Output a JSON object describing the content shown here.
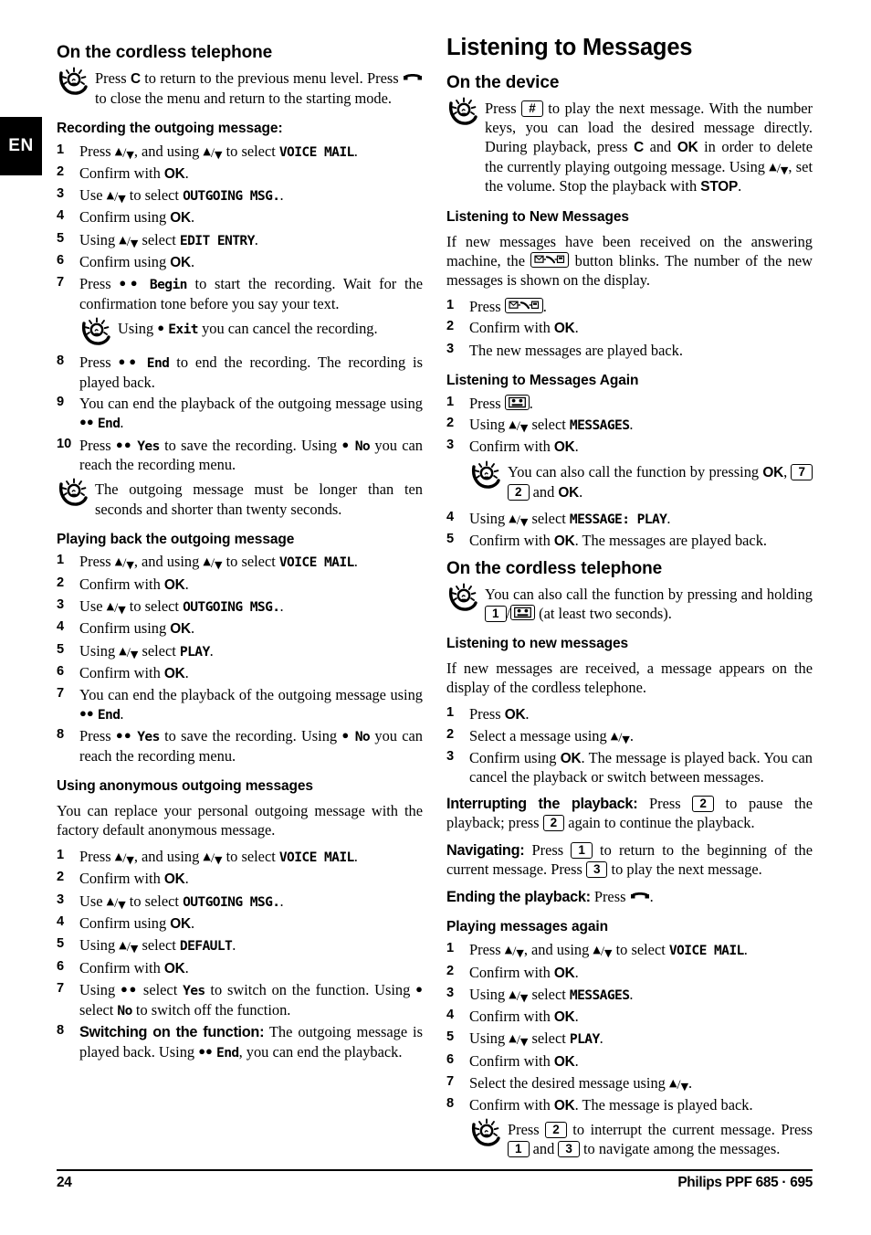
{
  "language_tab": "EN",
  "footer": {
    "page_number": "24",
    "product": "Philips PPF 685 · 695"
  },
  "left_column": {
    "section1_heading": "On the cordless telephone",
    "section1_tip_a": "Press ",
    "section1_tip_key": "C",
    "section1_tip_b": " to return to the previous menu level. Press ",
    "section1_tip_c": " to close the menu and return to the starting mode.",
    "section2_heading": "Recording the outgoing message:",
    "rec_steps": [
      {
        "n": "1",
        "pre": "Press ",
        "mid": ", and using ",
        "post": " to select ",
        "lcd": "VOICE MAIL",
        "tail": "."
      },
      {
        "n": "2",
        "text_a": "Confirm with ",
        "bold": "OK",
        "text_b": "."
      },
      {
        "n": "3",
        "pre": "Use ",
        "post": " to select ",
        "lcd": "OUTGOING MSG.",
        "tail": "."
      },
      {
        "n": "4",
        "text_a": "Confirm using ",
        "bold": "OK",
        "text_b": "."
      },
      {
        "n": "5",
        "pre": "Using ",
        "post": " select ",
        "lcd": "EDIT ENTRY",
        "tail": "."
      },
      {
        "n": "6",
        "text_a": "Confirm using ",
        "bold": "OK",
        "text_b": "."
      },
      {
        "n": "7",
        "pre": "Press ",
        "dots": "●●",
        "lcd": "Begin",
        "tail": " to start the recording. Wait for the confirmation tone before you say your text."
      }
    ],
    "rec_tip": {
      "pre": "Using ",
      "dots": "●",
      "lcd": "Exit",
      "post": " you can cancel the recording."
    },
    "rec_steps2": [
      {
        "n": "8",
        "pre": "Press ",
        "dots": "●●",
        "lcd": "End",
        "tail": " to end the recording. The recording is played back."
      },
      {
        "n": "9",
        "pre": "You can end the playback of the outgoing message using ",
        "dots": "●●",
        "lcd": "End",
        "tail": "."
      },
      {
        "n": "10",
        "pre": "Press ",
        "dots": "●●",
        "lcd": "Yes",
        "mid": " to save the recording. Using ",
        "dots2": "●",
        "lcd2": "No",
        "tail": " you can reach the recording menu."
      }
    ],
    "rec_tip2": "The outgoing message must be longer than ten seconds and shorter than twenty seconds.",
    "section3_heading": "Playing back the outgoing message",
    "play_steps": [
      {
        "n": "1",
        "pre": "Press ",
        "mid": ", and using ",
        "post": " to select ",
        "lcd": "VOICE MAIL",
        "tail": "."
      },
      {
        "n": "2",
        "text_a": "Confirm with ",
        "bold": "OK",
        "text_b": "."
      },
      {
        "n": "3",
        "pre": "Use ",
        "post": " to select ",
        "lcd": "OUTGOING MSG.",
        "tail": "."
      },
      {
        "n": "4",
        "text_a": "Confirm using ",
        "bold": "OK",
        "text_b": "."
      },
      {
        "n": "5",
        "pre": "Using ",
        "post": " select ",
        "lcd": "PLAY",
        "tail": "."
      },
      {
        "n": "6",
        "text_a": "Confirm with ",
        "bold": "OK",
        "text_b": "."
      },
      {
        "n": "7",
        "pre": "You can end the playback of the outgoing message using ",
        "dots": "●●",
        "lcd": "End",
        "tail": "."
      },
      {
        "n": "8",
        "pre": "Press ",
        "dots": "●●",
        "lcd": "Yes",
        "mid": " to save the recording. Using ",
        "dots2": "●",
        "lcd2": "No",
        "tail": " you can reach the recording menu."
      }
    ],
    "section4_heading": "Using anonymous outgoing messages",
    "section4_intro": "You can replace your personal outgoing message with the factory default anonymous message.",
    "anon_steps": [
      {
        "n": "1",
        "pre": "Press ",
        "mid": ", and using ",
        "post": " to select ",
        "lcd": "VOICE MAIL",
        "tail": "."
      },
      {
        "n": "2",
        "text_a": "Confirm with ",
        "bold": "OK",
        "text_b": "."
      },
      {
        "n": "3",
        "pre": "Use ",
        "post": " to select ",
        "lcd": "OUTGOING MSG.",
        "tail": "."
      },
      {
        "n": "4",
        "text_a": "Confirm using ",
        "bold": "OK",
        "text_b": "."
      },
      {
        "n": "5",
        "pre": "Using ",
        "post": " select ",
        "lcd": "DEFAULT",
        "tail": "."
      },
      {
        "n": "6",
        "text_a": "Confirm with ",
        "bold": "OK",
        "text_b": "."
      },
      {
        "n": "7",
        "pre": "Using ",
        "dots": "●●",
        "mid2": " select ",
        "lcd": "Yes",
        "mid": " to switch on the function. Using ",
        "dots2": "●",
        "mid3": " select ",
        "lcd2": "No",
        "tail": " to switch off the function."
      },
      {
        "n": "8",
        "lead": "Switching on the function:",
        "pre": " The outgoing message is played back. Using ",
        "dots": "●●",
        "lcd": "End",
        "tail": ", you can end the playback."
      }
    ]
  },
  "right_column": {
    "title": "Listening to Messages",
    "device_heading": "On the device",
    "device_tip_a": "Press ",
    "device_tip_key": "#",
    "device_tip_b": " to play the next message. With the number keys, you can load the desired message directly. During playback, press ",
    "device_tip_c": "C",
    "device_tip_d": " and ",
    "device_tip_e": "OK",
    "device_tip_f": " in order to delete the currently playing outgoing message. Using ",
    "device_tip_g": ", set the volume. Stop the playback with ",
    "device_tip_h": "STOP",
    "device_tip_i": ".",
    "newmsg_heading": "Listening to New Messages",
    "newmsg_intro_a": "If new messages have been received on the answering machine, the ",
    "newmsg_intro_b": " button blinks. The number of the new messages is shown on the display.",
    "newmsg_steps": [
      {
        "n": "1",
        "pre": "Press ",
        "icon": "answering-machine-key",
        "tail": "."
      },
      {
        "n": "2",
        "text_a": "Confirm with ",
        "bold": "OK",
        "text_b": "."
      },
      {
        "n": "3",
        "text_a": "The new messages are played back."
      }
    ],
    "again_heading": "Listening to Messages Again",
    "again_steps": [
      {
        "n": "1",
        "pre": "Press ",
        "icon": "cassette-key",
        "tail": "."
      },
      {
        "n": "2",
        "pre": "Using ",
        "post": " select ",
        "lcd": "MESSAGES",
        "tail": "."
      },
      {
        "n": "3",
        "text_a": "Confirm with ",
        "bold": "OK",
        "text_b": "."
      }
    ],
    "again_tip_a": "You can also call the function by pressing ",
    "again_tip_ok1": "OK",
    "again_tip_comma": ", ",
    "again_tip_key1": "7",
    "again_tip_key2": "2",
    "again_tip_and": " and ",
    "again_tip_ok2": "OK",
    "again_tip_end": ".",
    "again_steps2": [
      {
        "n": "4",
        "pre": "Using ",
        "post": " select ",
        "lcd": "MESSAGE: PLAY",
        "tail": "."
      },
      {
        "n": "5",
        "text_a": "Confirm with ",
        "bold": "OK",
        "text_b": ". The messages are played back."
      }
    ],
    "cordless_heading": "On the cordless telephone",
    "cordless_tip_a": "You can also call the function by pressing and holding ",
    "cordless_tip_key1": "1",
    "cordless_tip_slash": "/",
    "cordless_tip_b": " (at least two seconds).",
    "cordless_new_heading": "Listening to new messages",
    "cordless_new_intro": "If new messages are received, a message appears on the display of the cordless telephone.",
    "cordless_steps": [
      {
        "n": "1",
        "text_a": "Press ",
        "bold": "OK",
        "text_b": "."
      },
      {
        "n": "2",
        "pre": "Select a message using ",
        "tail": "."
      },
      {
        "n": "3",
        "text_a": "Confirm using ",
        "bold": "OK",
        "text_b": ". The message is played back. You can cancel the playback or switch between messages."
      }
    ],
    "interrupt_lead": "Interrupting the playback:",
    "interrupt_a": " Press ",
    "interrupt_key1": "2",
    "interrupt_b": " to pause the playback; press ",
    "interrupt_key2": "2",
    "interrupt_c": " again to continue the playback.",
    "navigating_lead": "Navigating:",
    "navigating_a": " Press ",
    "navigating_key1": "1",
    "navigating_b": " to return to the beginning of the current message. Press ",
    "navigating_key2": "3",
    "navigating_c": " to play the next message.",
    "ending_lead": "Ending the playback:",
    "ending_a": " Press ",
    "ending_b": ".",
    "playagain_heading": "Playing messages again",
    "playagain_steps": [
      {
        "n": "1",
        "pre": "Press ",
        "mid": ", and using ",
        "post": " to select ",
        "lcd": "VOICE MAIL",
        "tail": "."
      },
      {
        "n": "2",
        "text_a": "Confirm with ",
        "bold": "OK",
        "text_b": "."
      },
      {
        "n": "3",
        "pre": "Using ",
        "post": " select ",
        "lcd": "MESSAGES",
        "tail": "."
      },
      {
        "n": "4",
        "text_a": "Confirm with ",
        "bold": "OK",
        "text_b": "."
      },
      {
        "n": "5",
        "pre": "Using ",
        "post": " select ",
        "lcd": "PLAY",
        "tail": "."
      },
      {
        "n": "6",
        "text_a": "Confirm with ",
        "bold": "OK",
        "text_b": "."
      },
      {
        "n": "7",
        "pre": "Select the desired message using ",
        "tail": "."
      },
      {
        "n": "8",
        "text_a": "Confirm with ",
        "bold": "OK",
        "text_b": ". The message is played back."
      }
    ],
    "playagain_tip_a": "Press ",
    "playagain_tip_key1": "2",
    "playagain_tip_b": " to interrupt the current message. Press ",
    "playagain_tip_key2": "1",
    "playagain_tip_and": " and ",
    "playagain_tip_key3": "3",
    "playagain_tip_c": " to navigate among the messages."
  }
}
